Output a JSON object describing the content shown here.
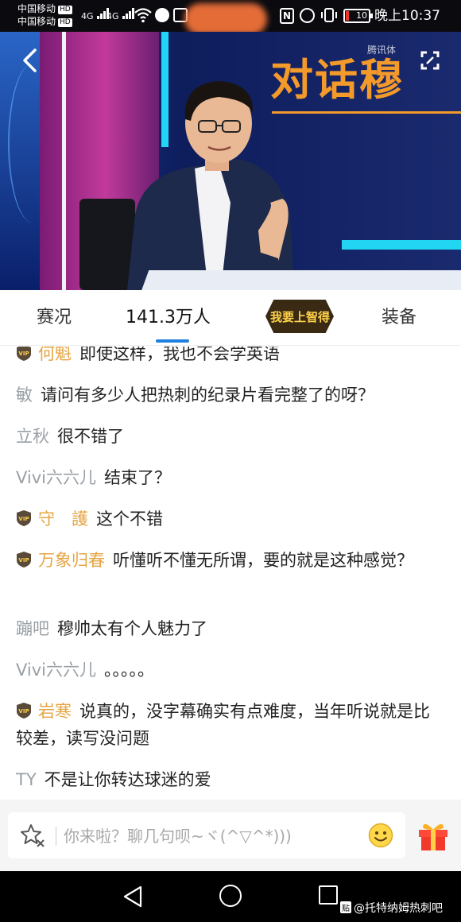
{
  "status_bar": {
    "carrier_1": "中国移动",
    "carrier_2": "中国移动",
    "hd_badge": "HD",
    "network_1": "4G",
    "network_2": "4G",
    "battery": "10",
    "time": "晚上10:37"
  },
  "video": {
    "title_overlay": "对话穆",
    "channel_logo": "腾讯体",
    "icons": [
      "back-icon",
      "expand-icon"
    ]
  },
  "tabs": {
    "status_label": "赛况",
    "viewers_label": "141.3万人",
    "promo_label": "我要上智得",
    "equipment_label": "装备",
    "active": "viewers"
  },
  "chat": {
    "messages": [
      {
        "name": "何魁",
        "vip": true,
        "text": "即使这样，我也不会学英语"
      },
      {
        "name": "敏",
        "vip": false,
        "text": "请问有多少人把热刺的纪录片看完整了的呀？"
      },
      {
        "name": "立秋",
        "vip": false,
        "text": "很不错了"
      },
      {
        "name": "Vivi六六儿",
        "vip": false,
        "text": "结束了？"
      },
      {
        "name": "守　護",
        "vip": true,
        "text": "这个不错"
      },
      {
        "name": "万象归春",
        "vip": true,
        "text": "听懂听不懂无所谓，要的就是这种感觉？"
      },
      {
        "name": "蹦吧",
        "vip": false,
        "text": "穆帅太有个人魅力了"
      },
      {
        "name": "Vivi六六儿",
        "vip": false,
        "text": "。。。。。"
      },
      {
        "name": "岩寒",
        "vip": true,
        "text": "说真的，没字幕确实有点难度，当年听说就是比较差，读写没问题"
      },
      {
        "name": "TY",
        "vip": false,
        "text": "不是让你转达球迷的爱"
      }
    ]
  },
  "input": {
    "placeholder": "你来啦？聊几句呗~ヾ(^▽^*)))",
    "value": ""
  },
  "nav": {
    "watermark_badge": "贴",
    "watermark": "@托特纳姆热刺吧"
  },
  "colors": {
    "accent_blue": "#1e7fe0",
    "vip_gold": "#e5a543",
    "username_gray": "#9aa0a6",
    "title_orange": "#f39a2a"
  }
}
